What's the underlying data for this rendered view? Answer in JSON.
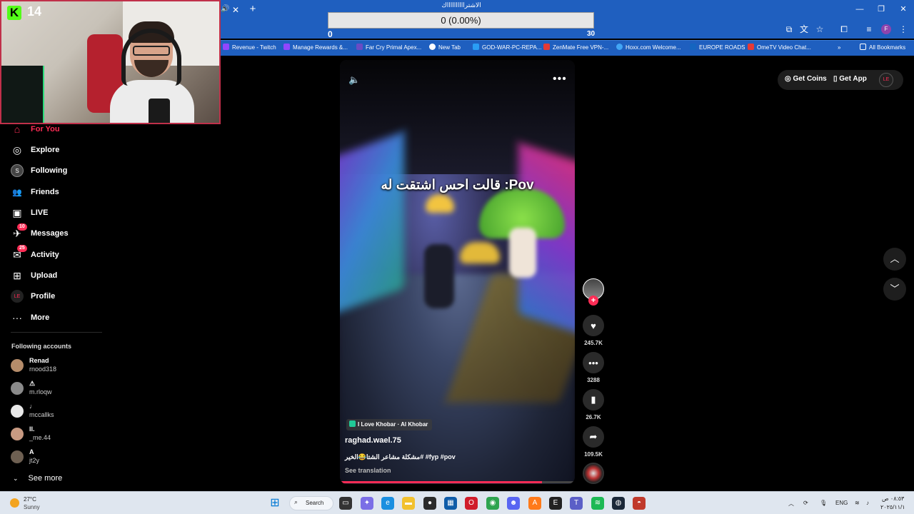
{
  "overlay": {
    "label": "الاشترااااااااااك",
    "progress_text": "0 (0.00%)",
    "progress_fraction": 0,
    "min": "0",
    "max": "30"
  },
  "webcam": {
    "logo_letter": "K",
    "count": "14"
  },
  "browser": {
    "window_controls": {
      "minimize": "—",
      "restore": "❐",
      "close": "✕"
    },
    "bookmarks": [
      {
        "label": "Revenue - Twitch",
        "color": "#9146ff"
      },
      {
        "label": "Manage Rewards &...",
        "color": "#9146ff"
      },
      {
        "label": "Far Cry Primal Apex...",
        "color": "#6a4cc4"
      },
      {
        "label": "New Tab",
        "color": "#ffffff"
      },
      {
        "label": "GOD-WAR-PC-REPA...",
        "color": "#2a9df4"
      },
      {
        "label": "ZenMate Free VPN-...",
        "color": "#e53935"
      },
      {
        "label": "Hoxx.com Welcome...",
        "color": "#42a5f5"
      },
      {
        "label": "EUROPE ROADS",
        "color": "#1565c0"
      },
      {
        "label": "OmeTV Video Chat...",
        "color": "#e53935"
      }
    ],
    "all_bookmarks": "All Bookmarks",
    "profile_initial": "F"
  },
  "sidebar": {
    "nav": [
      {
        "label": "For You",
        "icon": "home-icon",
        "glyph": "⌂"
      },
      {
        "label": "Explore",
        "icon": "compass-icon",
        "glyph": "◎"
      },
      {
        "label": "Following",
        "icon": "following-avatar-icon",
        "glyph": "S"
      },
      {
        "label": "Friends",
        "icon": "friends-icon",
        "glyph": "👥"
      },
      {
        "label": "LIVE",
        "icon": "live-icon",
        "glyph": "▣"
      },
      {
        "label": "Messages",
        "icon": "send-icon",
        "glyph": "✈",
        "badge": "10"
      },
      {
        "label": "Activity",
        "icon": "inbox-icon",
        "glyph": "✉",
        "badge": "25"
      },
      {
        "label": "Upload",
        "icon": "upload-icon",
        "glyph": "⊞"
      },
      {
        "label": "Profile",
        "icon": "profile-avatar-icon",
        "glyph": "LE"
      },
      {
        "label": "More",
        "icon": "more-icon",
        "glyph": "···"
      }
    ],
    "following_title": "Following accounts",
    "accounts": [
      {
        "name": "Renad",
        "handle": "rnood318",
        "color": "#b58c6a"
      },
      {
        "name": "⚠",
        "handle": "m.rloqw",
        "color": "#8a8a8a"
      },
      {
        "name": "♩",
        "handle": "mccallks",
        "color": "#e8e8e8"
      },
      {
        "name": "II.",
        "handle": "_me.44",
        "color": "#c89a82"
      },
      {
        "name": "A",
        "handle": "jt2y",
        "color": "#6e6052"
      }
    ],
    "see_more": "See more"
  },
  "topright": {
    "get_coins": "Get Coins",
    "get_app": "Get App",
    "avatar": "LE"
  },
  "video": {
    "caption": "قالت احس اشتقت له :Pov",
    "location": "I Love Khobar · Al Khobar",
    "username": "raghad.wael.75",
    "description": "مشكلة مشاعر الشتا😂الخير# #fyp #pov",
    "see_translation": "See translation",
    "progress_fraction": 0.86
  },
  "actions": {
    "likes": "245.7K",
    "comments": "3288",
    "saves": "26.7K",
    "shares": "109.5K"
  },
  "taskbar": {
    "temperature": "27°C",
    "condition": "Sunny",
    "search": "Search",
    "lang": "ENG",
    "time": "٠٨:٥٣ ص",
    "date": "٢٠٢٥/١١/١"
  }
}
